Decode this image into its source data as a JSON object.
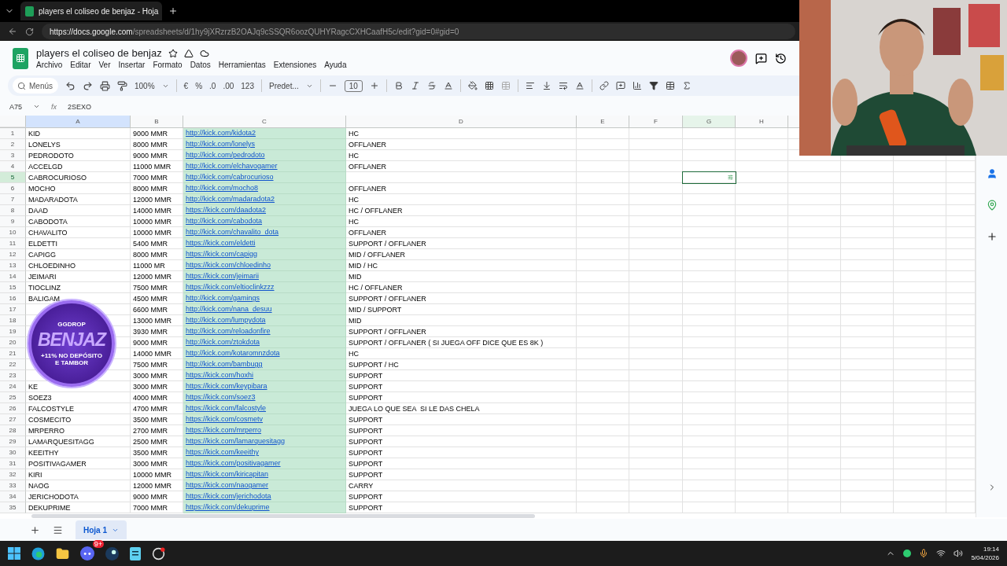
{
  "browser": {
    "tab_title": "players el coliseo de benjaz - Hoja",
    "url_host": "https://docs.google.com",
    "url_path": "/spreadsheets/d/1hy9jXRzrzB2OAJq9cSSQR6oozQUHYRagcCXHCaafH5c/edit?gid=0#gid=0"
  },
  "doc": {
    "title": "players el coliseo de benjaz",
    "menus": [
      "Archivo",
      "Editar",
      "Ver",
      "Insertar",
      "Formato",
      "Datos",
      "Herramientas",
      "Extensiones",
      "Ayuda"
    ]
  },
  "toolbar": {
    "search_placeholder": "Menús",
    "zoom": "100%",
    "currency": "€",
    "percent": "%",
    "decrease_decimals": ".0",
    "increase_decimals": ".00",
    "number_format": "123",
    "font": "Predet...",
    "font_size": "10"
  },
  "formula_bar": {
    "cell_ref": "A75",
    "fx": "fx",
    "value": "2SEXO"
  },
  "columns": [
    {
      "label": "A",
      "kind": "text",
      "selected": true,
      "filtered": false
    },
    {
      "label": "B",
      "kind": "text",
      "selected": false,
      "filtered": false
    },
    {
      "label": "C",
      "kind": "link",
      "selected": false,
      "filtered": false,
      "color": "#c9ead7"
    },
    {
      "label": "D",
      "kind": "text",
      "selected": false,
      "filtered": false
    },
    {
      "label": "E",
      "selected": false,
      "filtered": false
    },
    {
      "label": "F",
      "selected": false,
      "filtered": false
    },
    {
      "label": "G",
      "selected": false,
      "filtered": true
    },
    {
      "label": "H",
      "selected": false,
      "filtered": false
    }
  ],
  "rows": [
    {
      "number": "1",
      "name": "KID",
      "mmr": "9000 MMR",
      "link": "http://kick.com/kidota2",
      "role": "HC",
      "selected": false
    },
    {
      "number": "2",
      "name": "LONELYS",
      "mmr": "8000 MMR",
      "link": "http://kick.com/lonelys",
      "role": "OFFLANER",
      "selected": false
    },
    {
      "number": "3",
      "name": "PEDRODOTO",
      "mmr": "9000 MMR",
      "link": "http://kick.com/pedrodoto",
      "role": "HC",
      "selected": false
    },
    {
      "number": "4",
      "name": "ACCELGD",
      "mmr": "11000 MMR",
      "link": "http://kick.com/elchavogamer",
      "role": "OFFLANER",
      "selected": false
    },
    {
      "number": "5",
      "name": "CABROCURIOSO",
      "mmr": "7000 MMR",
      "link": "http://kick.com/cabrocurioso",
      "selected": true
    },
    {
      "number": "6",
      "name": "MOCHO",
      "mmr": "8000 MMR",
      "link": "http://kick.com/mocho8",
      "role": "OFFLANER",
      "selected": false
    },
    {
      "number": "7",
      "name": "MADARADOTA",
      "mmr": "12000 MMR",
      "link": "http://kick.com/madaradota2",
      "role": "HC",
      "selected": false
    },
    {
      "number": "8",
      "name": "DAAD",
      "mmr": "14000 MMR",
      "link": "https://kick.com/daadota2",
      "role": "HC / OFFLANER",
      "selected": false
    },
    {
      "number": "9",
      "name": "CABODOTA",
      "mmr": "10000 MMR",
      "link": "http://kick.com/cabodota",
      "role": "HC",
      "selected": false
    },
    {
      "number": "10",
      "name": "CHAVALITO",
      "mmr": "10000 MMR",
      "link": "http://kick.com/chavalito_dota",
      "role": "OFFLANER",
      "selected": false
    },
    {
      "number": "11",
      "name": "ELDETTI",
      "mmr": "5400 MMR",
      "link": "https://kick.com/eldetti",
      "role": "SUPPORT / OFFLANER",
      "selected": false
    },
    {
      "number": "12",
      "name": "CAPIGG",
      "mmr": "8000 MMR",
      "link": "https://kick.com/capigg",
      "role": "MID / OFFLANER",
      "selected": false
    },
    {
      "number": "13",
      "name": "CHLOEDINHO",
      "mmr": "11000 MR",
      "link": "https://kick.com/chloedinho",
      "role": "MID / HC",
      "selected": false
    },
    {
      "number": "14",
      "name": "JEIMARI",
      "mmr": "12000 MMR",
      "link": "https://kick.com/jeimarii",
      "role": "MID",
      "selected": false
    },
    {
      "number": "15",
      "name": "TIOCLINZ",
      "mmr": "7500 MMR",
      "link": "https://kick.com/eltioclinkzzz",
      "role": "HC / OFFLANER",
      "selected": false
    },
    {
      "number": "16",
      "name": "BALIGAM",
      "mmr": "4500 MMR",
      "link": "http://kick.com/gamings",
      "role": "SUPPORT / OFFLANER",
      "selected": false
    },
    {
      "number": "17",
      "mmr": "6600 MMR",
      "link": "http://kick.com/nana_desuu",
      "role": "MID / SUPPORT",
      "selected": false
    },
    {
      "number": "18",
      "mmr": "13000 MMR",
      "link": "http://kick.com/lumpydota",
      "role": "MID",
      "selected": false
    },
    {
      "number": "19",
      "mmr": "3930 MMR",
      "link": "http://kick.com/reloadonfire",
      "role": "SUPPORT / OFFLANER",
      "selected": false
    },
    {
      "number": "20",
      "mmr": "9000 MMR",
      "link": "http://kick.com/ztokdota",
      "role": "SUPPORT / OFFLANER ( SI JUEGA OFF DICE QUE ES 8K )",
      "selected": false
    },
    {
      "number": "21",
      "mmr": "14000 MMR",
      "link": "http://kick.com/kotaromnzdota",
      "role": "HC",
      "selected": false
    },
    {
      "number": "22",
      "mmr": "7500 MMR",
      "link": "http://kick.com/bambugg",
      "role": "SUPPORT / HC",
      "selected": false
    },
    {
      "number": "23",
      "mmr": "3000 MMR",
      "link": "https://kick.com/hoxhi",
      "role": "SUPPORT",
      "selected": false
    },
    {
      "number": "24",
      "name": "KE",
      "mmr": "3000 MMR",
      "link": "https://kick.com/keypibara",
      "role": "SUPPORT",
      "selected": false
    },
    {
      "number": "25",
      "name": "SOEZ3",
      "mmr": "4000 MMR",
      "link": "https://kick.com/soez3",
      "role": "SUPPORT",
      "selected": false
    },
    {
      "number": "26",
      "name": "FALCOSTYLE",
      "mmr": "4700 MMR",
      "link": "https://kick.com/falcostyle",
      "role": "JUEGA LO QUE SEA  SI LE DAS CHELA",
      "selected": false
    },
    {
      "number": "27",
      "name": "COSMECITO",
      "mmr": "3500 MMR",
      "link": "https://kick.com/cosmetv",
      "role": "SUPPORT",
      "selected": false
    },
    {
      "number": "28",
      "name": "MRPERRO",
      "mmr": "2700 MMR",
      "link": "https://kick.com/mrperro",
      "role": "SUPPORT",
      "selected": false
    },
    {
      "number": "29",
      "name": "LAMARQUESITAGG",
      "mmr": "2500 MMR",
      "link": "https://kick.com/lamarquesitagg",
      "role": "SUPPORT",
      "selected": false
    },
    {
      "number": "30",
      "name": "KEEITHY",
      "mmr": "3500 MMR",
      "link": "https://kick.com/keeithy",
      "role": "SUPPORT",
      "selected": false
    },
    {
      "number": "31",
      "name": "POSITIVAGAMER",
      "mmr": "3000 MMR",
      "link": "https://kick.com/positivagamer",
      "role": "SUPPORT",
      "selected": false
    },
    {
      "number": "32",
      "name": "KIRI",
      "mmr": "10000 MMR",
      "link": "https://kick.com/kiricapitan",
      "role": "SUPPORT",
      "selected": false
    },
    {
      "number": "33",
      "name": "NAOG",
      "mmr": "12000 MMR",
      "link": "https://kick.com/naogamer",
      "role": "CARRY",
      "selected": false
    },
    {
      "number": "34",
      "name": "JERICHODOTA",
      "mmr": "9000 MMR",
      "link": "https://kick.com/jerichodota",
      "role": "SUPPORT",
      "selected": false
    },
    {
      "number": "35",
      "name": "DEKUPRIME",
      "mmr": "7000 MMR",
      "link": "https://kick.com/dekuprime",
      "role": "SUPPORT",
      "selected": false
    }
  ],
  "sheet_tabs": [
    {
      "label": "Hoja 1",
      "selected": true
    }
  ],
  "promo_badge": {
    "brand": "GGDROP",
    "name": "BENJAZ",
    "offer": "+11% NO DEPÓSITO",
    "offer_line_2": "E TAMBOR"
  },
  "taskbar": {
    "discord_badge": "9+",
    "time": "19:14",
    "date": "5/04/2026"
  }
}
